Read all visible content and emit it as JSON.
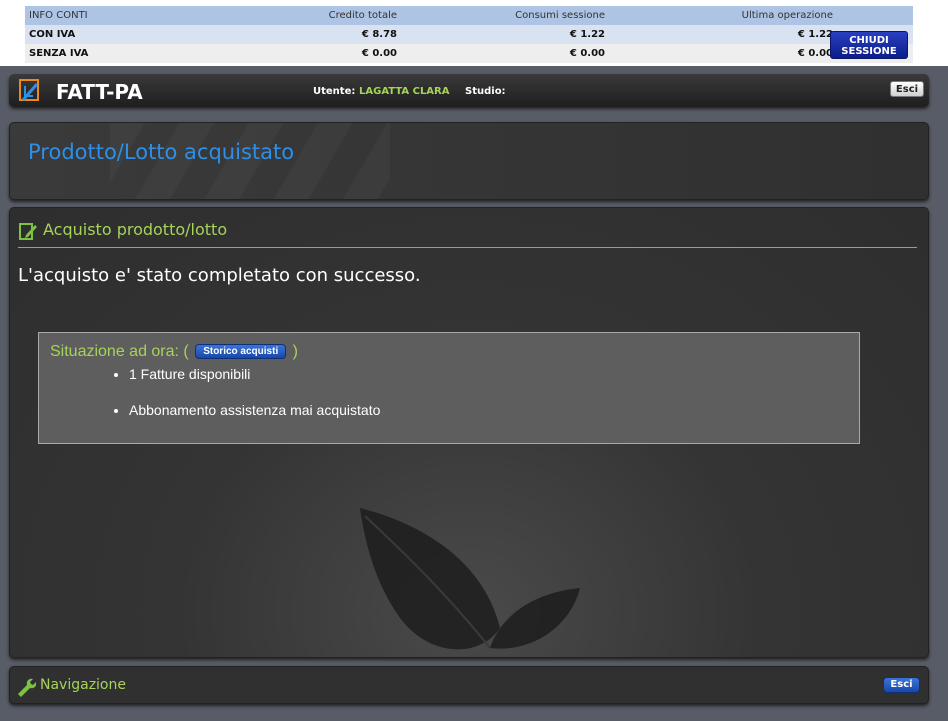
{
  "info": {
    "headers": [
      "INFO CONTI",
      "Credito totale",
      "Consumi sessione",
      "Ultima operazione"
    ],
    "rows": [
      {
        "label": "CON IVA",
        "credito": "€  8.78",
        "consumi": "€ 1.22",
        "ultima": "€ 1.22"
      },
      {
        "label": "SENZA IVA",
        "credito": "€  0.00",
        "consumi": "€ 0.00",
        "ultima": "€ 0.00"
      }
    ],
    "close_button": "CHIUDI SESSIONE"
  },
  "header": {
    "app_name": "FATT-PA",
    "user_label": "Utente:",
    "user_value": "LAGATTA CLARA",
    "studio_label": "Studio:",
    "exit_label": "Esci"
  },
  "page": {
    "title": "Prodotto/Lotto acquistato"
  },
  "section": {
    "title": "Acquisto prodotto/lotto",
    "message": "L'acquisto e' stato completato con successo."
  },
  "status_box": {
    "heading_prefix": "Situazione ad ora: (",
    "history_button": "Storico acquisti",
    "heading_suffix": ")",
    "items": [
      "1 Fatture disponibili",
      "Abbonamento assistenza mai acquistato"
    ]
  },
  "nav": {
    "title": "Navigazione",
    "exit_label": "Esci"
  },
  "colors": {
    "accent_green": "#a6d35a",
    "title_blue": "#2d8fe8",
    "button_blue": "#1848a8"
  }
}
